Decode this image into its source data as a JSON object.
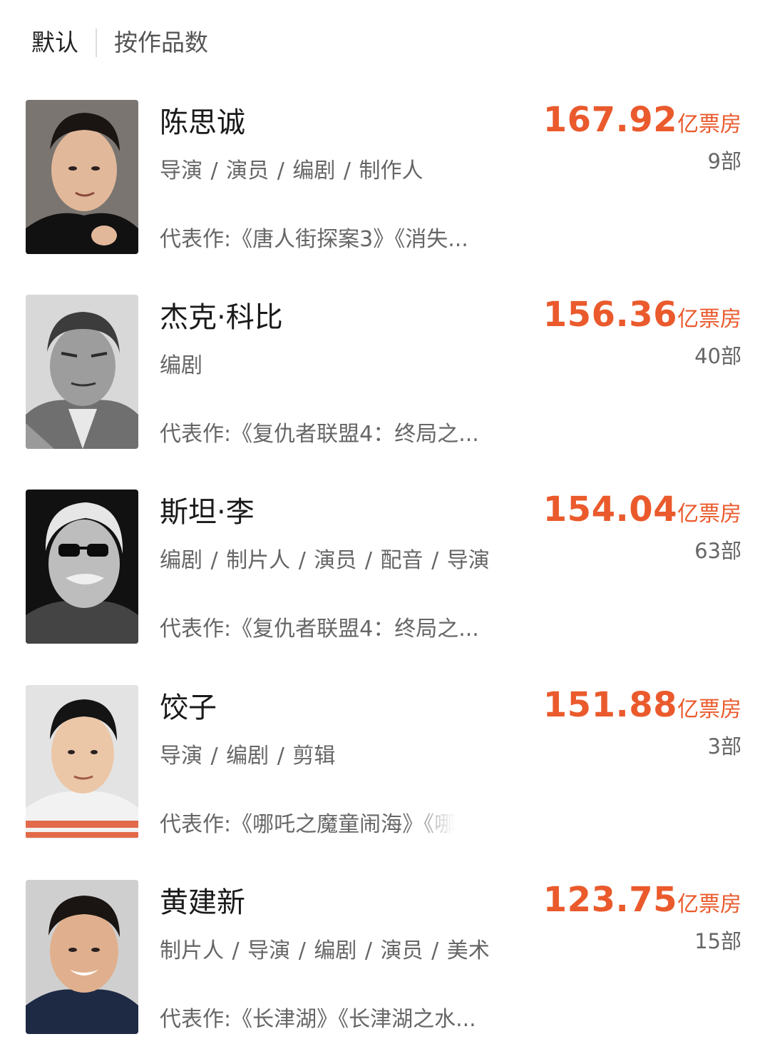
{
  "tabs": [
    {
      "label": "默认"
    },
    {
      "label": "按作品数"
    }
  ],
  "colors": {
    "accent": "#ea5a2c",
    "text": "#1a1a1a",
    "secondary": "#666666"
  },
  "people": [
    {
      "name": "陈思诚",
      "roles": "导演 / 演员 / 编剧 / 制作人",
      "works_label": "代表作:",
      "works": "《唐人街探案3》《消失...",
      "box_value": "167.92",
      "box_unit": "亿票房",
      "count": "9部"
    },
    {
      "name": "杰克·科比",
      "roles": "编剧",
      "works_label": "代表作:",
      "works": "《复仇者联盟4：终局之...",
      "box_value": "156.36",
      "box_unit": "亿票房",
      "count": "40部"
    },
    {
      "name": "斯坦·李",
      "roles": "编剧 / 制片人 / 演员 / 配音 / 导演",
      "works_label": "代表作:",
      "works": "《复仇者联盟4：终局之...",
      "box_value": "154.04",
      "box_unit": "亿票房",
      "count": "63部"
    },
    {
      "name": "饺子",
      "roles": "导演 / 编剧 / 剪辑",
      "works_label": "代表作:",
      "works": "《哪吒之魔童闹海》《哪",
      "box_value": "151.88",
      "box_unit": "亿票房",
      "count": "3部"
    },
    {
      "name": "黄建新",
      "roles": "制片人 / 导演 / 编剧 / 演员 / 美术",
      "works_label": "代表作:",
      "works": "《长津湖》《长津湖之水...",
      "box_value": "123.75",
      "box_unit": "亿票房",
      "count": "15部"
    }
  ]
}
